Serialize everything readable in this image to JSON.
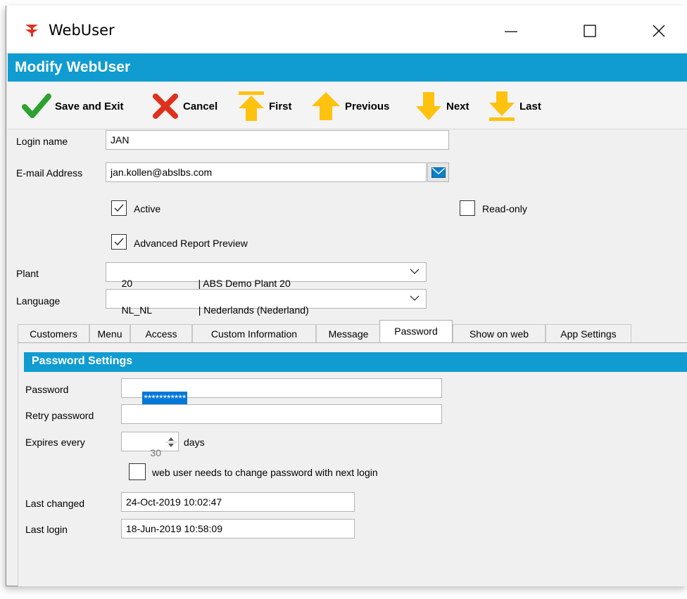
{
  "window": {
    "title": "WebUser",
    "icon": "red-arrow-icon"
  },
  "header": {
    "title": "Modify WebUser"
  },
  "toolbar": {
    "save_label": "Save and Exit",
    "cancel_label": "Cancel",
    "first_label": "First",
    "previous_label": "Previous",
    "next_label": "Next",
    "last_label": "Last"
  },
  "form": {
    "login_label": "Login name",
    "login_value": "JAN",
    "email_label": "E-mail Address",
    "email_value": "jan.kollen@abslbs.com",
    "active_label": "Active",
    "active_checked": true,
    "readonly_label": "Read-only",
    "readonly_checked": false,
    "advanced_label": "Advanced Report Preview",
    "advanced_checked": true,
    "plant_label": "Plant",
    "plant_value": "20                        | ABS Demo Plant 20",
    "language_label": "Language",
    "language_value": "NL_NL                 | Nederlands (Nederland)"
  },
  "tabs": [
    "Customers",
    "Menu",
    "Access",
    "Custom Information",
    "Message",
    "Password",
    "Show on web",
    "App Settings"
  ],
  "active_tab": "Password",
  "password": {
    "section_title": "Password Settings",
    "password_label": "Password",
    "password_value": "***********",
    "retry_label": "Retry password",
    "retry_value": "",
    "expires_label": "Expires every",
    "expires_value": "30",
    "expires_unit": "days",
    "change_label": "web user needs to change password with next login",
    "change_checked": false,
    "last_changed_label": "Last changed",
    "last_changed_value": "24-Oct-2019 10:02:47",
    "last_login_label": "Last login",
    "last_login_value": "18-Jun-2019 10:58:09"
  },
  "colors": {
    "accent": "#109cd0",
    "save_green": "#2ea12e",
    "cancel_red": "#e0301e",
    "nav_yellow": "#ffc20e",
    "selection_blue": "#0078d7"
  }
}
